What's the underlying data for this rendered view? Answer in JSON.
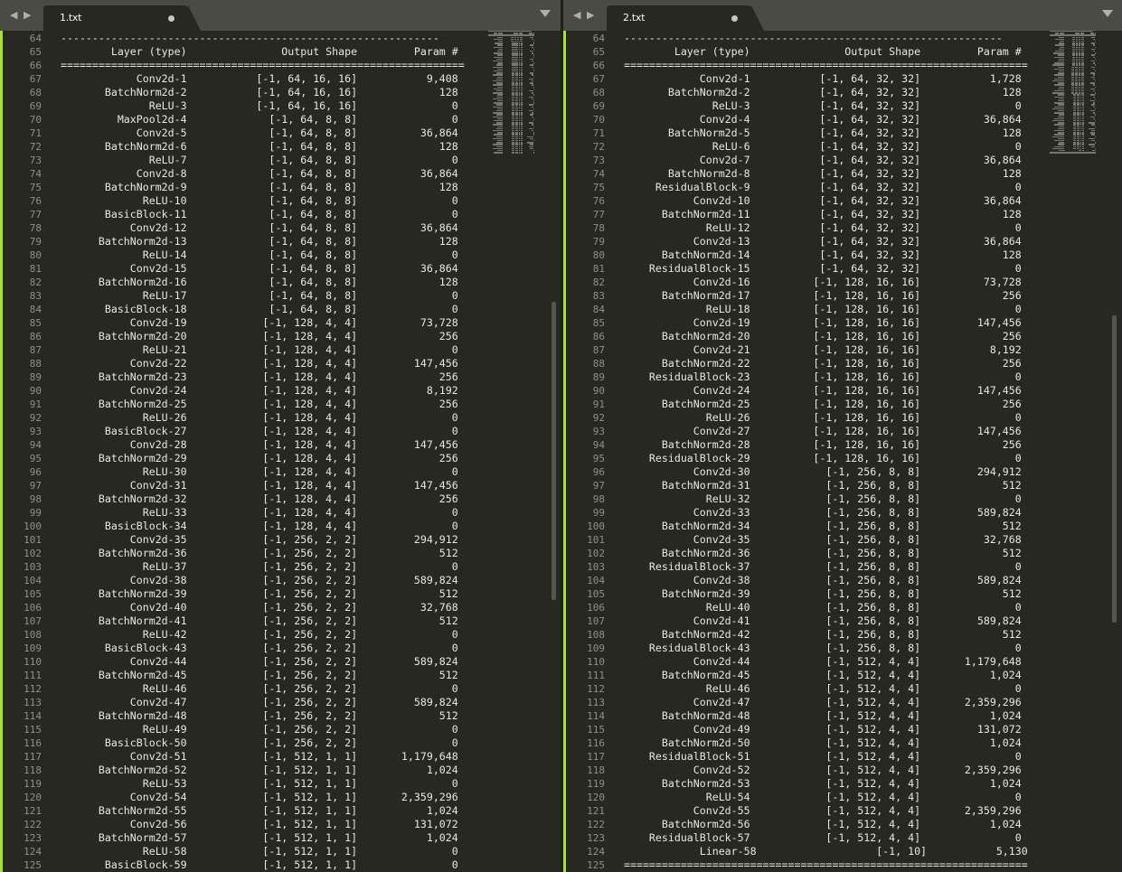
{
  "nav": {
    "back": "◀",
    "forward": "▶",
    "dropdown_icon": "chevron-down-icon"
  },
  "accent": "#a6e22e",
  "panes": [
    {
      "tab_title": "1.txt",
      "first_line": 64,
      "lines": [
        "------------------------------------------------------------",
        "        Layer (type)               Output Shape         Param #",
        "================================================================",
        "            Conv2d-1           [-1, 64, 16, 16]           9,408",
        "       BatchNorm2d-2           [-1, 64, 16, 16]             128",
        "              ReLU-3           [-1, 64, 16, 16]               0",
        "         MaxPool2d-4             [-1, 64, 8, 8]               0",
        "            Conv2d-5             [-1, 64, 8, 8]          36,864",
        "       BatchNorm2d-6             [-1, 64, 8, 8]             128",
        "              ReLU-7             [-1, 64, 8, 8]               0",
        "            Conv2d-8             [-1, 64, 8, 8]          36,864",
        "       BatchNorm2d-9             [-1, 64, 8, 8]             128",
        "             ReLU-10             [-1, 64, 8, 8]               0",
        "       BasicBlock-11             [-1, 64, 8, 8]               0",
        "           Conv2d-12             [-1, 64, 8, 8]          36,864",
        "      BatchNorm2d-13             [-1, 64, 8, 8]             128",
        "             ReLU-14             [-1, 64, 8, 8]               0",
        "           Conv2d-15             [-1, 64, 8, 8]          36,864",
        "      BatchNorm2d-16             [-1, 64, 8, 8]             128",
        "             ReLU-17             [-1, 64, 8, 8]               0",
        "       BasicBlock-18             [-1, 64, 8, 8]               0",
        "           Conv2d-19            [-1, 128, 4, 4]          73,728",
        "      BatchNorm2d-20            [-1, 128, 4, 4]             256",
        "             ReLU-21            [-1, 128, 4, 4]               0",
        "           Conv2d-22            [-1, 128, 4, 4]         147,456",
        "      BatchNorm2d-23            [-1, 128, 4, 4]             256",
        "           Conv2d-24            [-1, 128, 4, 4]           8,192",
        "      BatchNorm2d-25            [-1, 128, 4, 4]             256",
        "             ReLU-26            [-1, 128, 4, 4]               0",
        "       BasicBlock-27            [-1, 128, 4, 4]               0",
        "           Conv2d-28            [-1, 128, 4, 4]         147,456",
        "      BatchNorm2d-29            [-1, 128, 4, 4]             256",
        "             ReLU-30            [-1, 128, 4, 4]               0",
        "           Conv2d-31            [-1, 128, 4, 4]         147,456",
        "      BatchNorm2d-32            [-1, 128, 4, 4]             256",
        "             ReLU-33            [-1, 128, 4, 4]               0",
        "       BasicBlock-34            [-1, 128, 4, 4]               0",
        "           Conv2d-35            [-1, 256, 2, 2]         294,912",
        "      BatchNorm2d-36            [-1, 256, 2, 2]             512",
        "             ReLU-37            [-1, 256, 2, 2]               0",
        "           Conv2d-38            [-1, 256, 2, 2]         589,824",
        "      BatchNorm2d-39            [-1, 256, 2, 2]             512",
        "           Conv2d-40            [-1, 256, 2, 2]          32,768",
        "      BatchNorm2d-41            [-1, 256, 2, 2]             512",
        "             ReLU-42            [-1, 256, 2, 2]               0",
        "       BasicBlock-43            [-1, 256, 2, 2]               0",
        "           Conv2d-44            [-1, 256, 2, 2]         589,824",
        "      BatchNorm2d-45            [-1, 256, 2, 2]             512",
        "             ReLU-46            [-1, 256, 2, 2]               0",
        "           Conv2d-47            [-1, 256, 2, 2]         589,824",
        "      BatchNorm2d-48            [-1, 256, 2, 2]             512",
        "             ReLU-49            [-1, 256, 2, 2]               0",
        "       BasicBlock-50            [-1, 256, 2, 2]               0",
        "           Conv2d-51            [-1, 512, 1, 1]       1,179,648",
        "      BatchNorm2d-52            [-1, 512, 1, 1]           1,024",
        "             ReLU-53            [-1, 512, 1, 1]               0",
        "           Conv2d-54            [-1, 512, 1, 1]       2,359,296",
        "      BatchNorm2d-55            [-1, 512, 1, 1]           1,024",
        "           Conv2d-56            [-1, 512, 1, 1]         131,072",
        "      BatchNorm2d-57            [-1, 512, 1, 1]           1,024",
        "             ReLU-58            [-1, 512, 1, 1]               0",
        "       BasicBlock-59            [-1, 512, 1, 1]               0"
      ]
    },
    {
      "tab_title": "2.txt",
      "first_line": 64,
      "lines": [
        "------------------------------------------------------------",
        "        Layer (type)               Output Shape         Param #",
        "================================================================",
        "            Conv2d-1           [-1, 64, 32, 32]           1,728",
        "       BatchNorm2d-2           [-1, 64, 32, 32]             128",
        "              ReLU-3           [-1, 64, 32, 32]               0",
        "            Conv2d-4           [-1, 64, 32, 32]          36,864",
        "       BatchNorm2d-5           [-1, 64, 32, 32]             128",
        "              ReLU-6           [-1, 64, 32, 32]               0",
        "            Conv2d-7           [-1, 64, 32, 32]          36,864",
        "       BatchNorm2d-8           [-1, 64, 32, 32]             128",
        "     ResidualBlock-9           [-1, 64, 32, 32]               0",
        "           Conv2d-10           [-1, 64, 32, 32]          36,864",
        "      BatchNorm2d-11           [-1, 64, 32, 32]             128",
        "             ReLU-12           [-1, 64, 32, 32]               0",
        "           Conv2d-13           [-1, 64, 32, 32]          36,864",
        "      BatchNorm2d-14           [-1, 64, 32, 32]             128",
        "    ResidualBlock-15           [-1, 64, 32, 32]               0",
        "           Conv2d-16          [-1, 128, 16, 16]          73,728",
        "      BatchNorm2d-17          [-1, 128, 16, 16]             256",
        "             ReLU-18          [-1, 128, 16, 16]               0",
        "           Conv2d-19          [-1, 128, 16, 16]         147,456",
        "      BatchNorm2d-20          [-1, 128, 16, 16]             256",
        "           Conv2d-21          [-1, 128, 16, 16]           8,192",
        "      BatchNorm2d-22          [-1, 128, 16, 16]             256",
        "    ResidualBlock-23          [-1, 128, 16, 16]               0",
        "           Conv2d-24          [-1, 128, 16, 16]         147,456",
        "      BatchNorm2d-25          [-1, 128, 16, 16]             256",
        "             ReLU-26          [-1, 128, 16, 16]               0",
        "           Conv2d-27          [-1, 128, 16, 16]         147,456",
        "      BatchNorm2d-28          [-1, 128, 16, 16]             256",
        "    ResidualBlock-29          [-1, 128, 16, 16]               0",
        "           Conv2d-30            [-1, 256, 8, 8]         294,912",
        "      BatchNorm2d-31            [-1, 256, 8, 8]             512",
        "             ReLU-32            [-1, 256, 8, 8]               0",
        "           Conv2d-33            [-1, 256, 8, 8]         589,824",
        "      BatchNorm2d-34            [-1, 256, 8, 8]             512",
        "           Conv2d-35            [-1, 256, 8, 8]          32,768",
        "      BatchNorm2d-36            [-1, 256, 8, 8]             512",
        "    ResidualBlock-37            [-1, 256, 8, 8]               0",
        "           Conv2d-38            [-1, 256, 8, 8]         589,824",
        "      BatchNorm2d-39            [-1, 256, 8, 8]             512",
        "             ReLU-40            [-1, 256, 8, 8]               0",
        "           Conv2d-41            [-1, 256, 8, 8]         589,824",
        "      BatchNorm2d-42            [-1, 256, 8, 8]             512",
        "    ResidualBlock-43            [-1, 256, 8, 8]               0",
        "           Conv2d-44            [-1, 512, 4, 4]       1,179,648",
        "      BatchNorm2d-45            [-1, 512, 4, 4]           1,024",
        "             ReLU-46            [-1, 512, 4, 4]               0",
        "           Conv2d-47            [-1, 512, 4, 4]       2,359,296",
        "      BatchNorm2d-48            [-1, 512, 4, 4]           1,024",
        "           Conv2d-49            [-1, 512, 4, 4]         131,072",
        "      BatchNorm2d-50            [-1, 512, 4, 4]           1,024",
        "    ResidualBlock-51            [-1, 512, 4, 4]               0",
        "           Conv2d-52            [-1, 512, 4, 4]       2,359,296",
        "      BatchNorm2d-53            [-1, 512, 4, 4]           1,024",
        "             ReLU-54            [-1, 512, 4, 4]               0",
        "           Conv2d-55            [-1, 512, 4, 4]       2,359,296",
        "      BatchNorm2d-56            [-1, 512, 4, 4]           1,024",
        "    ResidualBlock-57            [-1, 512, 4, 4]               0",
        "            Linear-58                   [-1, 10]           5,130",
        "================================================================"
      ]
    }
  ]
}
